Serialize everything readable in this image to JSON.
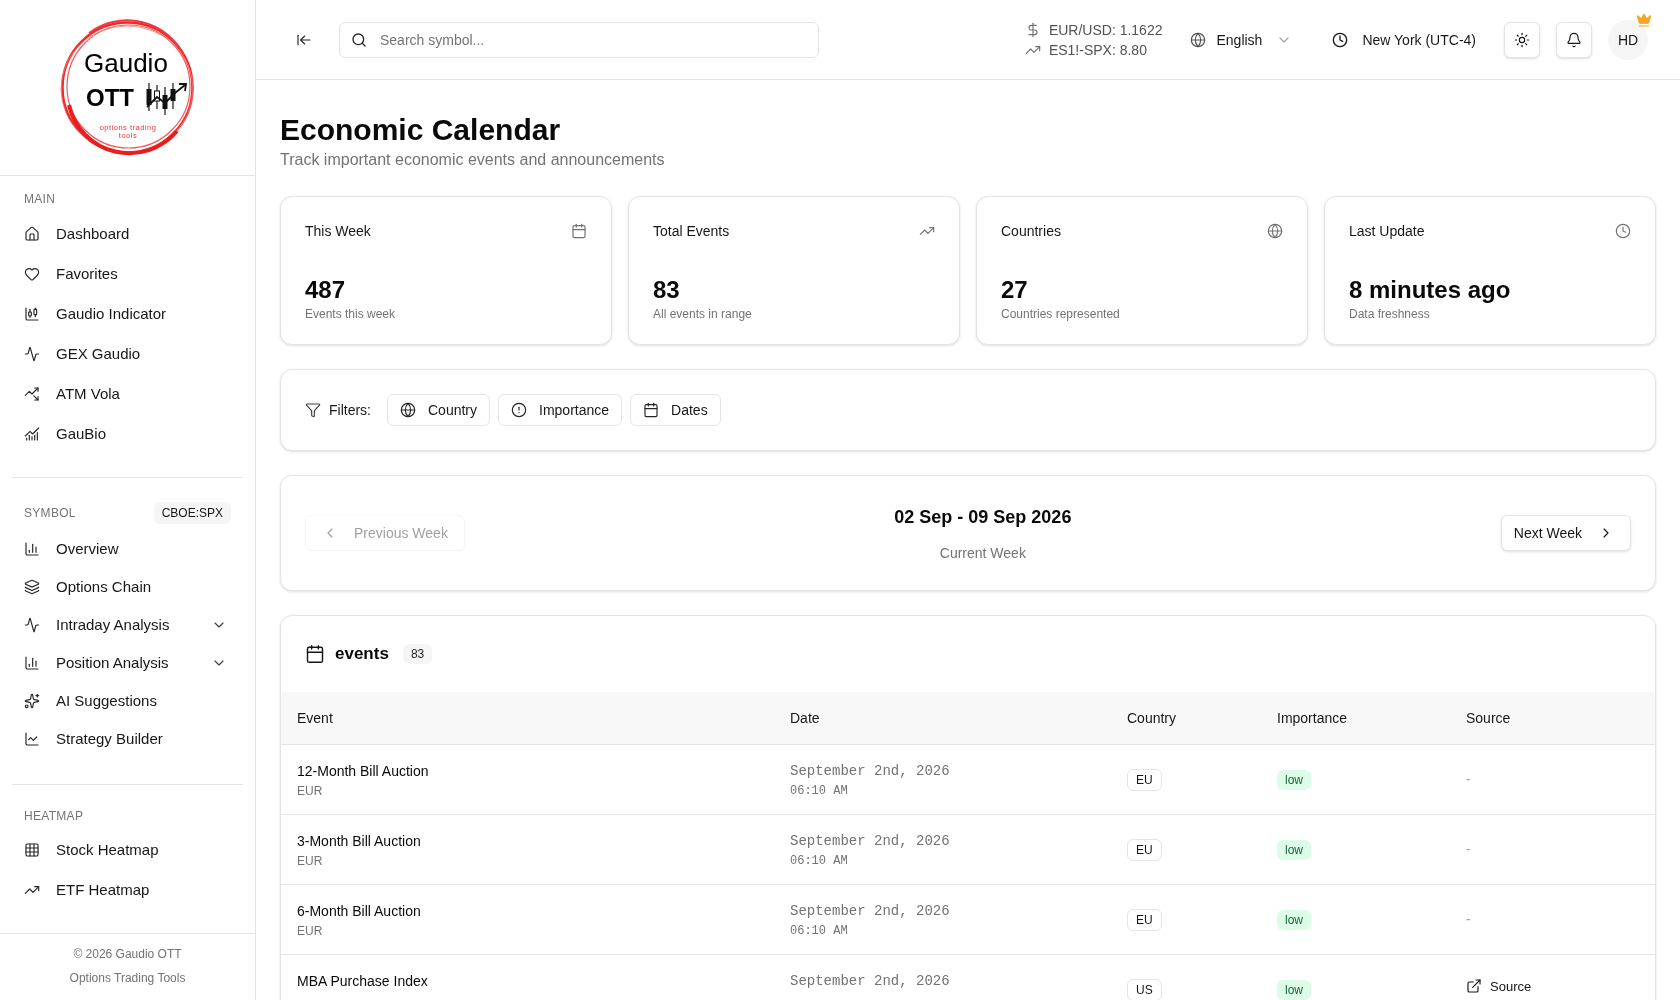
{
  "sidebar": {
    "logo": {
      "title": "Gaudio",
      "subtitle": "OTT",
      "tagline": "options trading tools"
    },
    "sections": [
      {
        "label": "MAIN",
        "items": [
          {
            "label": "Dashboard"
          },
          {
            "label": "Favorites"
          },
          {
            "label": "Gaudio Indicator"
          },
          {
            "label": "GEX Gaudio"
          },
          {
            "label": "ATM Vola"
          },
          {
            "label": "GauBio"
          }
        ]
      },
      {
        "label": "SYMBOL",
        "badge": "CBOE:SPX",
        "items": [
          {
            "label": "Overview"
          },
          {
            "label": "Options Chain"
          },
          {
            "label": "Intraday Analysis",
            "expanded": false
          },
          {
            "label": "Position Analysis",
            "expanded": false
          },
          {
            "label": "AI Suggestions"
          },
          {
            "label": "Strategy Builder"
          }
        ]
      },
      {
        "label": "HEATMAP",
        "items": [
          {
            "label": "Stock Heatmap"
          },
          {
            "label": "ETF Heatmap"
          }
        ]
      }
    ],
    "footer": [
      "© 2026 Gaudio OTT",
      "Options Trading Tools"
    ]
  },
  "header": {
    "search": {
      "placeholder": "Search symbol..."
    },
    "tickers": [
      "EUR/USD: 1.1622",
      "ES1!-SPX: 8.80"
    ],
    "language": "English",
    "timezone": "New York (UTC-4)",
    "avatar": "HD"
  },
  "page": {
    "title": "Economic Calendar",
    "subtitle": "Track important economic events and announcements"
  },
  "stats": [
    {
      "title": "This Week",
      "value": "487",
      "caption": "Events this week"
    },
    {
      "title": "Total Events",
      "value": "83",
      "caption": "All events in range"
    },
    {
      "title": "Countries",
      "value": "27",
      "caption": "Countries represented"
    },
    {
      "title": "Last Update",
      "value": "8 minutes ago",
      "caption": "Data freshness"
    }
  ],
  "filters": {
    "label": "Filters:",
    "buttons": [
      "Country",
      "Importance",
      "Dates"
    ]
  },
  "week": {
    "previous": {
      "label": "Previous Week",
      "disabled": true
    },
    "range": "02 Sep - 09 Sep 2026",
    "caption": "Current Week",
    "next": {
      "label": "Next Week",
      "disabled": false
    }
  },
  "events": {
    "title": "events",
    "count": "83",
    "columns": [
      "Event",
      "Date",
      "Country",
      "Importance",
      "Source"
    ],
    "rows": [
      {
        "event": "12-Month Bill Auction",
        "currency": "EUR",
        "date": "September 2nd, 2026",
        "time": "06:10 AM",
        "country": "EU",
        "importance": "low",
        "source": {
          "kind": "text",
          "text": "-"
        }
      },
      {
        "event": "3-Month Bill Auction",
        "currency": "EUR",
        "date": "September 2nd, 2026",
        "time": "06:10 AM",
        "country": "EU",
        "importance": "low",
        "source": {
          "kind": "text",
          "text": "-"
        }
      },
      {
        "event": "6-Month Bill Auction",
        "currency": "EUR",
        "date": "September 2nd, 2026",
        "time": "06:10 AM",
        "country": "EU",
        "importance": "low",
        "source": {
          "kind": "text",
          "text": "-"
        }
      },
      {
        "event": "MBA Purchase Index",
        "date": "September 2nd, 2026",
        "country": "US",
        "importance": "low",
        "source": {
          "kind": "link",
          "text": "Source"
        }
      }
    ]
  }
}
